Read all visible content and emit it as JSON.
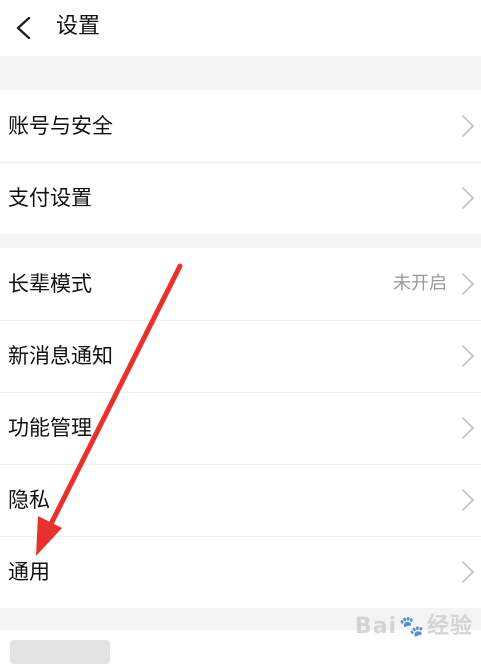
{
  "header": {
    "title": "设置",
    "back_icon": "chevron-left-icon"
  },
  "groups": [
    {
      "items": [
        {
          "label": "账号与安全",
          "value": ""
        },
        {
          "label": "支付设置",
          "value": ""
        }
      ]
    },
    {
      "items": [
        {
          "label": "长辈模式",
          "value": "未开启"
        },
        {
          "label": "新消息通知",
          "value": ""
        },
        {
          "label": "功能管理",
          "value": ""
        },
        {
          "label": "隐私",
          "value": ""
        },
        {
          "label": "通用",
          "value": ""
        }
      ]
    }
  ],
  "annotation": {
    "arrow_color": "#e8302c",
    "icon": "red-arrow-annotation"
  },
  "watermark": {
    "text_left": "Bai",
    "text_right": "经验",
    "icon": "paw-icon"
  }
}
